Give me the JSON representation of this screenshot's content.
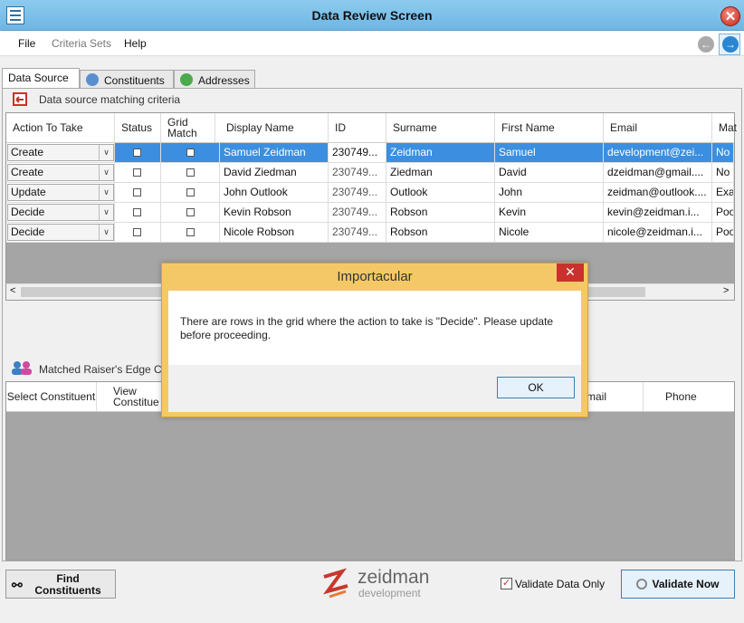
{
  "window": {
    "title": "Data Review Screen"
  },
  "menu": {
    "file": "File",
    "criteria_sets": "Criteria Sets",
    "help": "Help"
  },
  "tabs": [
    {
      "label": "Data Source",
      "active": true
    },
    {
      "label": "Constituents",
      "active": false
    },
    {
      "label": "Addresses",
      "active": false
    }
  ],
  "source_section": {
    "title": "Data source matching criteria"
  },
  "source_grid": {
    "headers": [
      "Action To Take",
      "Status",
      "Grid Match",
      "Display Name",
      "ID",
      "Surname",
      "First Name",
      "Email",
      "Mat"
    ],
    "rows": [
      {
        "action": "Create",
        "name": "Samuel Zeidman",
        "id": "230749...",
        "surname": "Zeidman",
        "first": "Samuel",
        "email": "development@zei...",
        "mat": "No N",
        "selected": true
      },
      {
        "action": "Create",
        "name": "David Ziedman",
        "id": "230749...",
        "surname": "Ziedman",
        "first": "David",
        "email": "dzeidman@gmail....",
        "mat": "No M",
        "selected": false
      },
      {
        "action": "Update",
        "name": "John Outlook",
        "id": "230749...",
        "surname": "Outlook",
        "first": "John",
        "email": "zeidman@outlook....",
        "mat": "Exac",
        "selected": false
      },
      {
        "action": "Decide",
        "name": "Kevin Robson",
        "id": "230749...",
        "surname": "Robson",
        "first": "Kevin",
        "email": "kevin@zeidman.i...",
        "mat": "Poo",
        "selected": false
      },
      {
        "action": "Decide",
        "name": "Nicole Robson",
        "id": "230749...",
        "surname": "Robson",
        "first": "Nicole",
        "email": "nicole@zeidman.i...",
        "mat": "Poo",
        "selected": false
      }
    ]
  },
  "matched_section": {
    "title": "Matched Raiser's Edge C"
  },
  "matched_grid": {
    "headers": [
      "Select Constituent",
      "View Constitue",
      "mail",
      "Phone"
    ]
  },
  "footer": {
    "find_button": "Find Constituents",
    "logo_name": "zeidman",
    "logo_sub": "development",
    "validate_only_label": "Validate Data Only",
    "validate_only_checked": true,
    "validate_button": "Validate Now"
  },
  "dialog": {
    "title": "Importacular",
    "message": "There are rows in the grid where the action to take is \"Decide\". Please update before proceeding.",
    "ok": "OK",
    "close_symbol": "✕"
  },
  "colors": {
    "selection": "#3c8fe0",
    "dialog_frame": "#f5c867",
    "titlebar": "#7fc0ea"
  }
}
